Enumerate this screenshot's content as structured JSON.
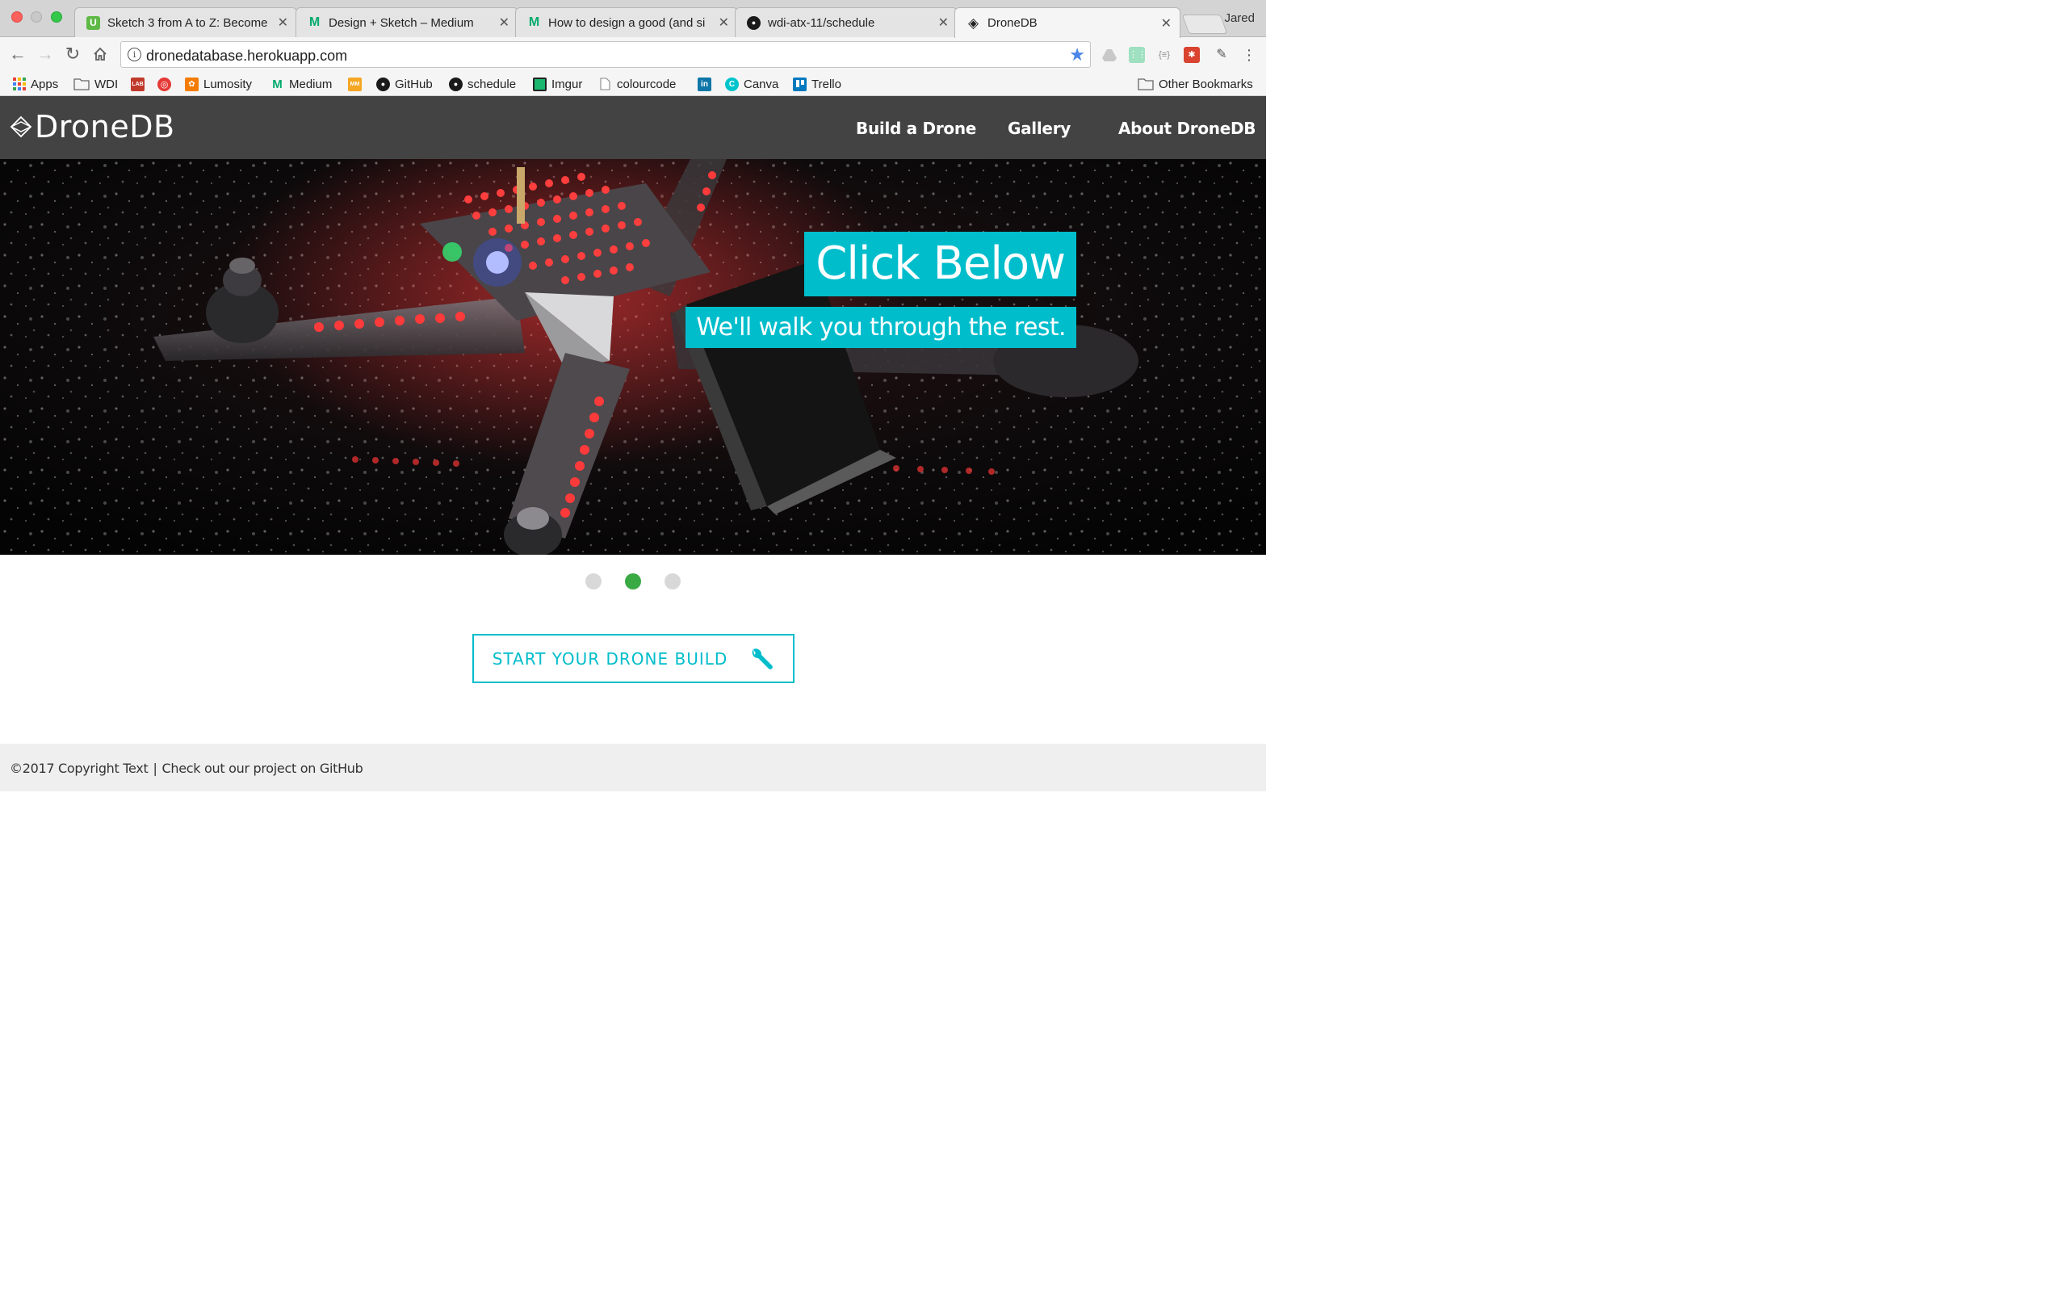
{
  "browser": {
    "tabs": [
      {
        "title": "Sketch 3 from A to Z: Become",
        "favicon": "udemy-icon",
        "favicon_color": "#5fb946",
        "favicon_glyph": "U"
      },
      {
        "title": "Design + Sketch – Medium",
        "favicon": "medium-icon",
        "favicon_color": "#00ab6c",
        "favicon_glyph": "M"
      },
      {
        "title": "How to design a good (and si",
        "favicon": "medium-icon",
        "favicon_color": "#00ab6c",
        "favicon_glyph": "M"
      },
      {
        "title": "wdi-atx-11/schedule",
        "favicon": "github-icon",
        "favicon_color": "#1a1a1a",
        "favicon_glyph": "●"
      },
      {
        "title": "DroneDB",
        "favicon": "dronedb-icon",
        "favicon_color": "#222222",
        "favicon_glyph": "◈"
      }
    ],
    "profile_name": "Jared",
    "url": "dronedatabase.herokuapp.com",
    "bookmarks": [
      {
        "label": "Apps",
        "icon": "apps-grid-icon"
      },
      {
        "label": "WDI",
        "icon": "folder-icon"
      },
      {
        "label": "",
        "icon": "lab-icon"
      },
      {
        "label": "",
        "icon": "aperture-icon"
      },
      {
        "label": "Lumosity",
        "icon": "lumosity-icon"
      },
      {
        "label": "Medium",
        "icon": "medium-icon"
      },
      {
        "label": "",
        "icon": "mm-icon"
      },
      {
        "label": "GitHub",
        "icon": "github-icon"
      },
      {
        "label": "schedule",
        "icon": "github-icon"
      },
      {
        "label": "Imgur",
        "icon": "imgur-icon"
      },
      {
        "label": "colourcode",
        "icon": "page-icon"
      },
      {
        "label": "",
        "icon": "linkedin-icon"
      },
      {
        "label": "Canva",
        "icon": "canva-icon"
      },
      {
        "label": "Trello",
        "icon": "trello-icon"
      }
    ],
    "other_bookmarks": "Other Bookmarks"
  },
  "site": {
    "logo_text": "DroneDB",
    "nav": [
      "Build a Drone",
      "Gallery",
      "About DroneDB"
    ],
    "hero": {
      "title": "Click Below",
      "subtitle": "We'll walk you through the rest."
    },
    "carousel": {
      "count": 3,
      "active_index": 1
    },
    "cta_label": "START YOUR DRONE BUILD",
    "footer_copyright": "©2017 Copyright Text",
    "footer_separator": "|",
    "footer_link": "Check out our project on GitHub"
  },
  "colors": {
    "accent": "#00bdcc",
    "header_bg": "#434343",
    "active_dot": "#3aaa45",
    "footer_bg": "#efefef"
  }
}
